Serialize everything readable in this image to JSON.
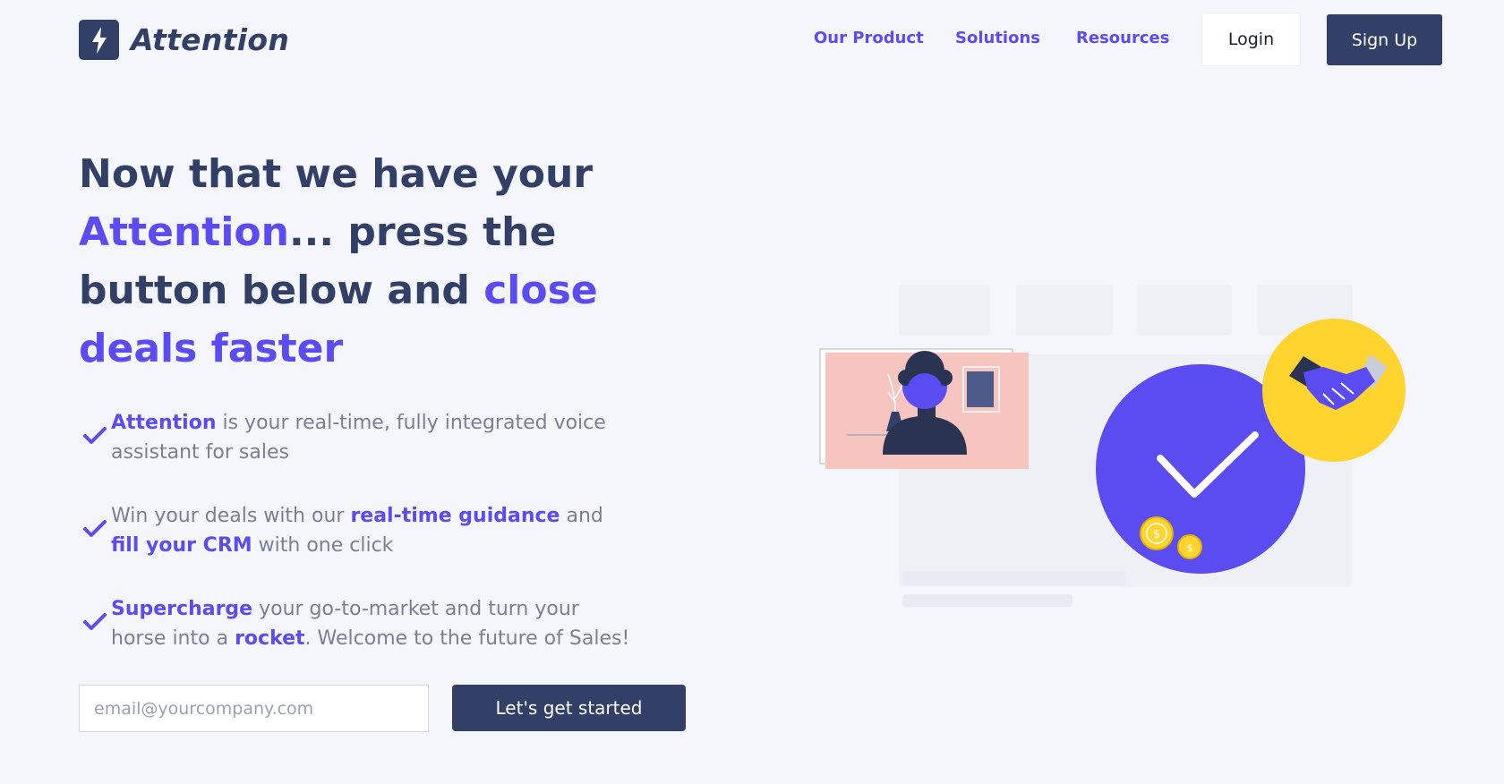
{
  "brand": {
    "name": "Attention",
    "logo_icon": "lightning-bolt-icon",
    "primary_color": "#323f66",
    "accent_color": "#5a4cf0"
  },
  "nav": {
    "links": [
      {
        "label": "Our Product"
      },
      {
        "label": "Solutions"
      },
      {
        "label": "Resources"
      }
    ],
    "login_label": "Login",
    "signup_label": "Sign Up"
  },
  "hero": {
    "headline": {
      "part1": "Now that we have your ",
      "accent1": "Attention",
      "part2": "... press the button below and ",
      "accent2": "close deals faster"
    },
    "features": [
      {
        "icon": "checkmark-icon",
        "seg1": "Attention",
        "seg2": " is your real-time, fully integrated voice assistant for sales"
      },
      {
        "icon": "checkmark-icon",
        "seg1": "Win your deals with our ",
        "seg2": "real-time guidance",
        "seg3": " and ",
        "seg4": "fill your CRM",
        "seg5": " with one click"
      },
      {
        "icon": "checkmark-icon",
        "seg1": "Supercharge",
        "seg2": " your go-to-market and turn your horse into a ",
        "seg3": "rocket",
        "seg4": ". Welcome to the future of Sales!"
      }
    ],
    "email_placeholder": "email@yourcompany.com",
    "email_value": "",
    "cta_label": "Let's get started"
  },
  "illustration": {
    "icons": [
      "person-video-call-icon",
      "checkmark-circle-icon",
      "handshake-icon",
      "coin-icon"
    ],
    "colors": {
      "pink": "#f6c5c0",
      "purple": "#5a4cf0",
      "yellow": "#ffd42e",
      "navy": "#2a3352"
    }
  }
}
